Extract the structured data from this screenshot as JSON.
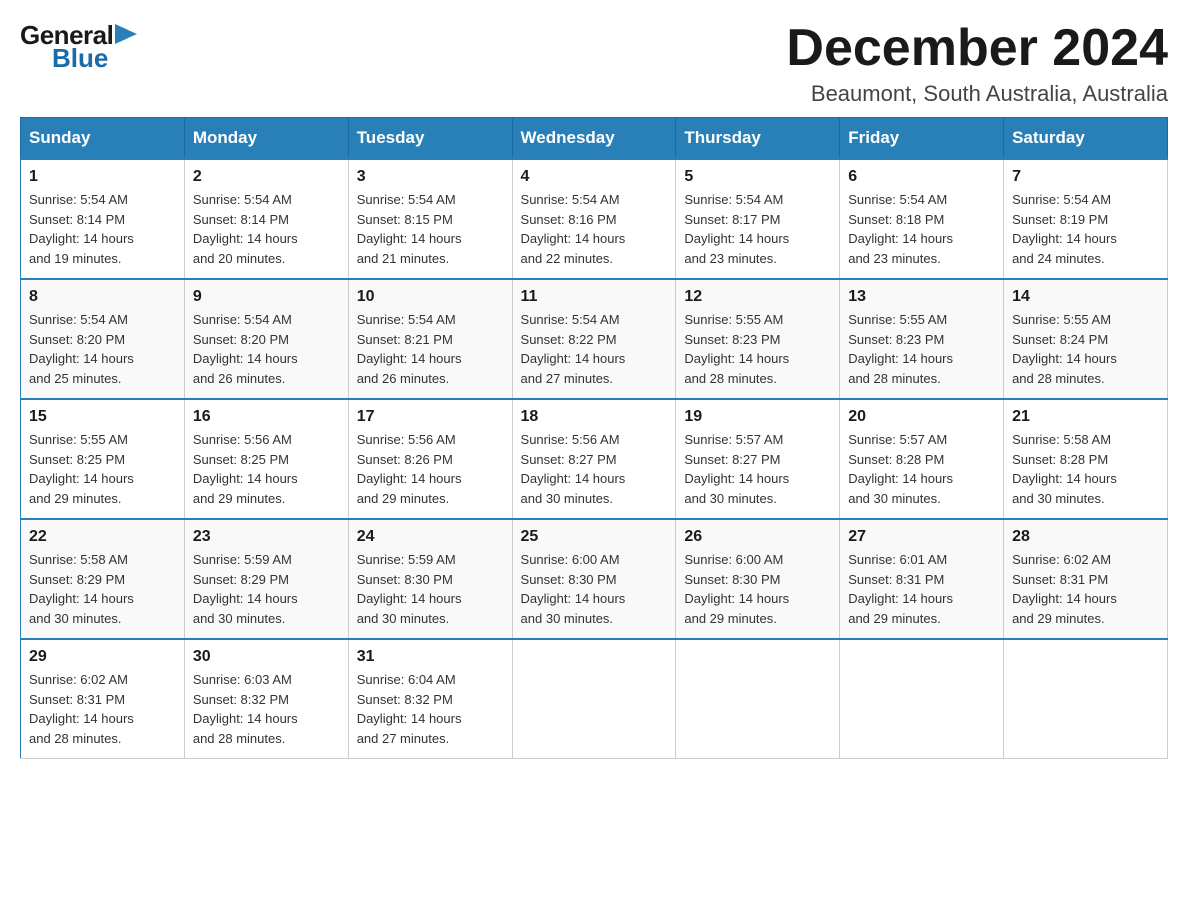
{
  "header": {
    "logo_general": "General",
    "logo_blue": "Blue",
    "month_title": "December 2024",
    "subtitle": "Beaumont, South Australia, Australia"
  },
  "days_of_week": [
    "Sunday",
    "Monday",
    "Tuesday",
    "Wednesday",
    "Thursday",
    "Friday",
    "Saturday"
  ],
  "weeks": [
    [
      {
        "day": "1",
        "sunrise": "5:54 AM",
        "sunset": "8:14 PM",
        "daylight": "14 hours and 19 minutes."
      },
      {
        "day": "2",
        "sunrise": "5:54 AM",
        "sunset": "8:14 PM",
        "daylight": "14 hours and 20 minutes."
      },
      {
        "day": "3",
        "sunrise": "5:54 AM",
        "sunset": "8:15 PM",
        "daylight": "14 hours and 21 minutes."
      },
      {
        "day": "4",
        "sunrise": "5:54 AM",
        "sunset": "8:16 PM",
        "daylight": "14 hours and 22 minutes."
      },
      {
        "day": "5",
        "sunrise": "5:54 AM",
        "sunset": "8:17 PM",
        "daylight": "14 hours and 23 minutes."
      },
      {
        "day": "6",
        "sunrise": "5:54 AM",
        "sunset": "8:18 PM",
        "daylight": "14 hours and 23 minutes."
      },
      {
        "day": "7",
        "sunrise": "5:54 AM",
        "sunset": "8:19 PM",
        "daylight": "14 hours and 24 minutes."
      }
    ],
    [
      {
        "day": "8",
        "sunrise": "5:54 AM",
        "sunset": "8:20 PM",
        "daylight": "14 hours and 25 minutes."
      },
      {
        "day": "9",
        "sunrise": "5:54 AM",
        "sunset": "8:20 PM",
        "daylight": "14 hours and 26 minutes."
      },
      {
        "day": "10",
        "sunrise": "5:54 AM",
        "sunset": "8:21 PM",
        "daylight": "14 hours and 26 minutes."
      },
      {
        "day": "11",
        "sunrise": "5:54 AM",
        "sunset": "8:22 PM",
        "daylight": "14 hours and 27 minutes."
      },
      {
        "day": "12",
        "sunrise": "5:55 AM",
        "sunset": "8:23 PM",
        "daylight": "14 hours and 28 minutes."
      },
      {
        "day": "13",
        "sunrise": "5:55 AM",
        "sunset": "8:23 PM",
        "daylight": "14 hours and 28 minutes."
      },
      {
        "day": "14",
        "sunrise": "5:55 AM",
        "sunset": "8:24 PM",
        "daylight": "14 hours and 28 minutes."
      }
    ],
    [
      {
        "day": "15",
        "sunrise": "5:55 AM",
        "sunset": "8:25 PM",
        "daylight": "14 hours and 29 minutes."
      },
      {
        "day": "16",
        "sunrise": "5:56 AM",
        "sunset": "8:25 PM",
        "daylight": "14 hours and 29 minutes."
      },
      {
        "day": "17",
        "sunrise": "5:56 AM",
        "sunset": "8:26 PM",
        "daylight": "14 hours and 29 minutes."
      },
      {
        "day": "18",
        "sunrise": "5:56 AM",
        "sunset": "8:27 PM",
        "daylight": "14 hours and 30 minutes."
      },
      {
        "day": "19",
        "sunrise": "5:57 AM",
        "sunset": "8:27 PM",
        "daylight": "14 hours and 30 minutes."
      },
      {
        "day": "20",
        "sunrise": "5:57 AM",
        "sunset": "8:28 PM",
        "daylight": "14 hours and 30 minutes."
      },
      {
        "day": "21",
        "sunrise": "5:58 AM",
        "sunset": "8:28 PM",
        "daylight": "14 hours and 30 minutes."
      }
    ],
    [
      {
        "day": "22",
        "sunrise": "5:58 AM",
        "sunset": "8:29 PM",
        "daylight": "14 hours and 30 minutes."
      },
      {
        "day": "23",
        "sunrise": "5:59 AM",
        "sunset": "8:29 PM",
        "daylight": "14 hours and 30 minutes."
      },
      {
        "day": "24",
        "sunrise": "5:59 AM",
        "sunset": "8:30 PM",
        "daylight": "14 hours and 30 minutes."
      },
      {
        "day": "25",
        "sunrise": "6:00 AM",
        "sunset": "8:30 PM",
        "daylight": "14 hours and 30 minutes."
      },
      {
        "day": "26",
        "sunrise": "6:00 AM",
        "sunset": "8:30 PM",
        "daylight": "14 hours and 29 minutes."
      },
      {
        "day": "27",
        "sunrise": "6:01 AM",
        "sunset": "8:31 PM",
        "daylight": "14 hours and 29 minutes."
      },
      {
        "day": "28",
        "sunrise": "6:02 AM",
        "sunset": "8:31 PM",
        "daylight": "14 hours and 29 minutes."
      }
    ],
    [
      {
        "day": "29",
        "sunrise": "6:02 AM",
        "sunset": "8:31 PM",
        "daylight": "14 hours and 28 minutes."
      },
      {
        "day": "30",
        "sunrise": "6:03 AM",
        "sunset": "8:32 PM",
        "daylight": "14 hours and 28 minutes."
      },
      {
        "day": "31",
        "sunrise": "6:04 AM",
        "sunset": "8:32 PM",
        "daylight": "14 hours and 27 minutes."
      },
      null,
      null,
      null,
      null
    ]
  ],
  "labels": {
    "sunrise": "Sunrise:",
    "sunset": "Sunset:",
    "daylight": "Daylight:"
  }
}
